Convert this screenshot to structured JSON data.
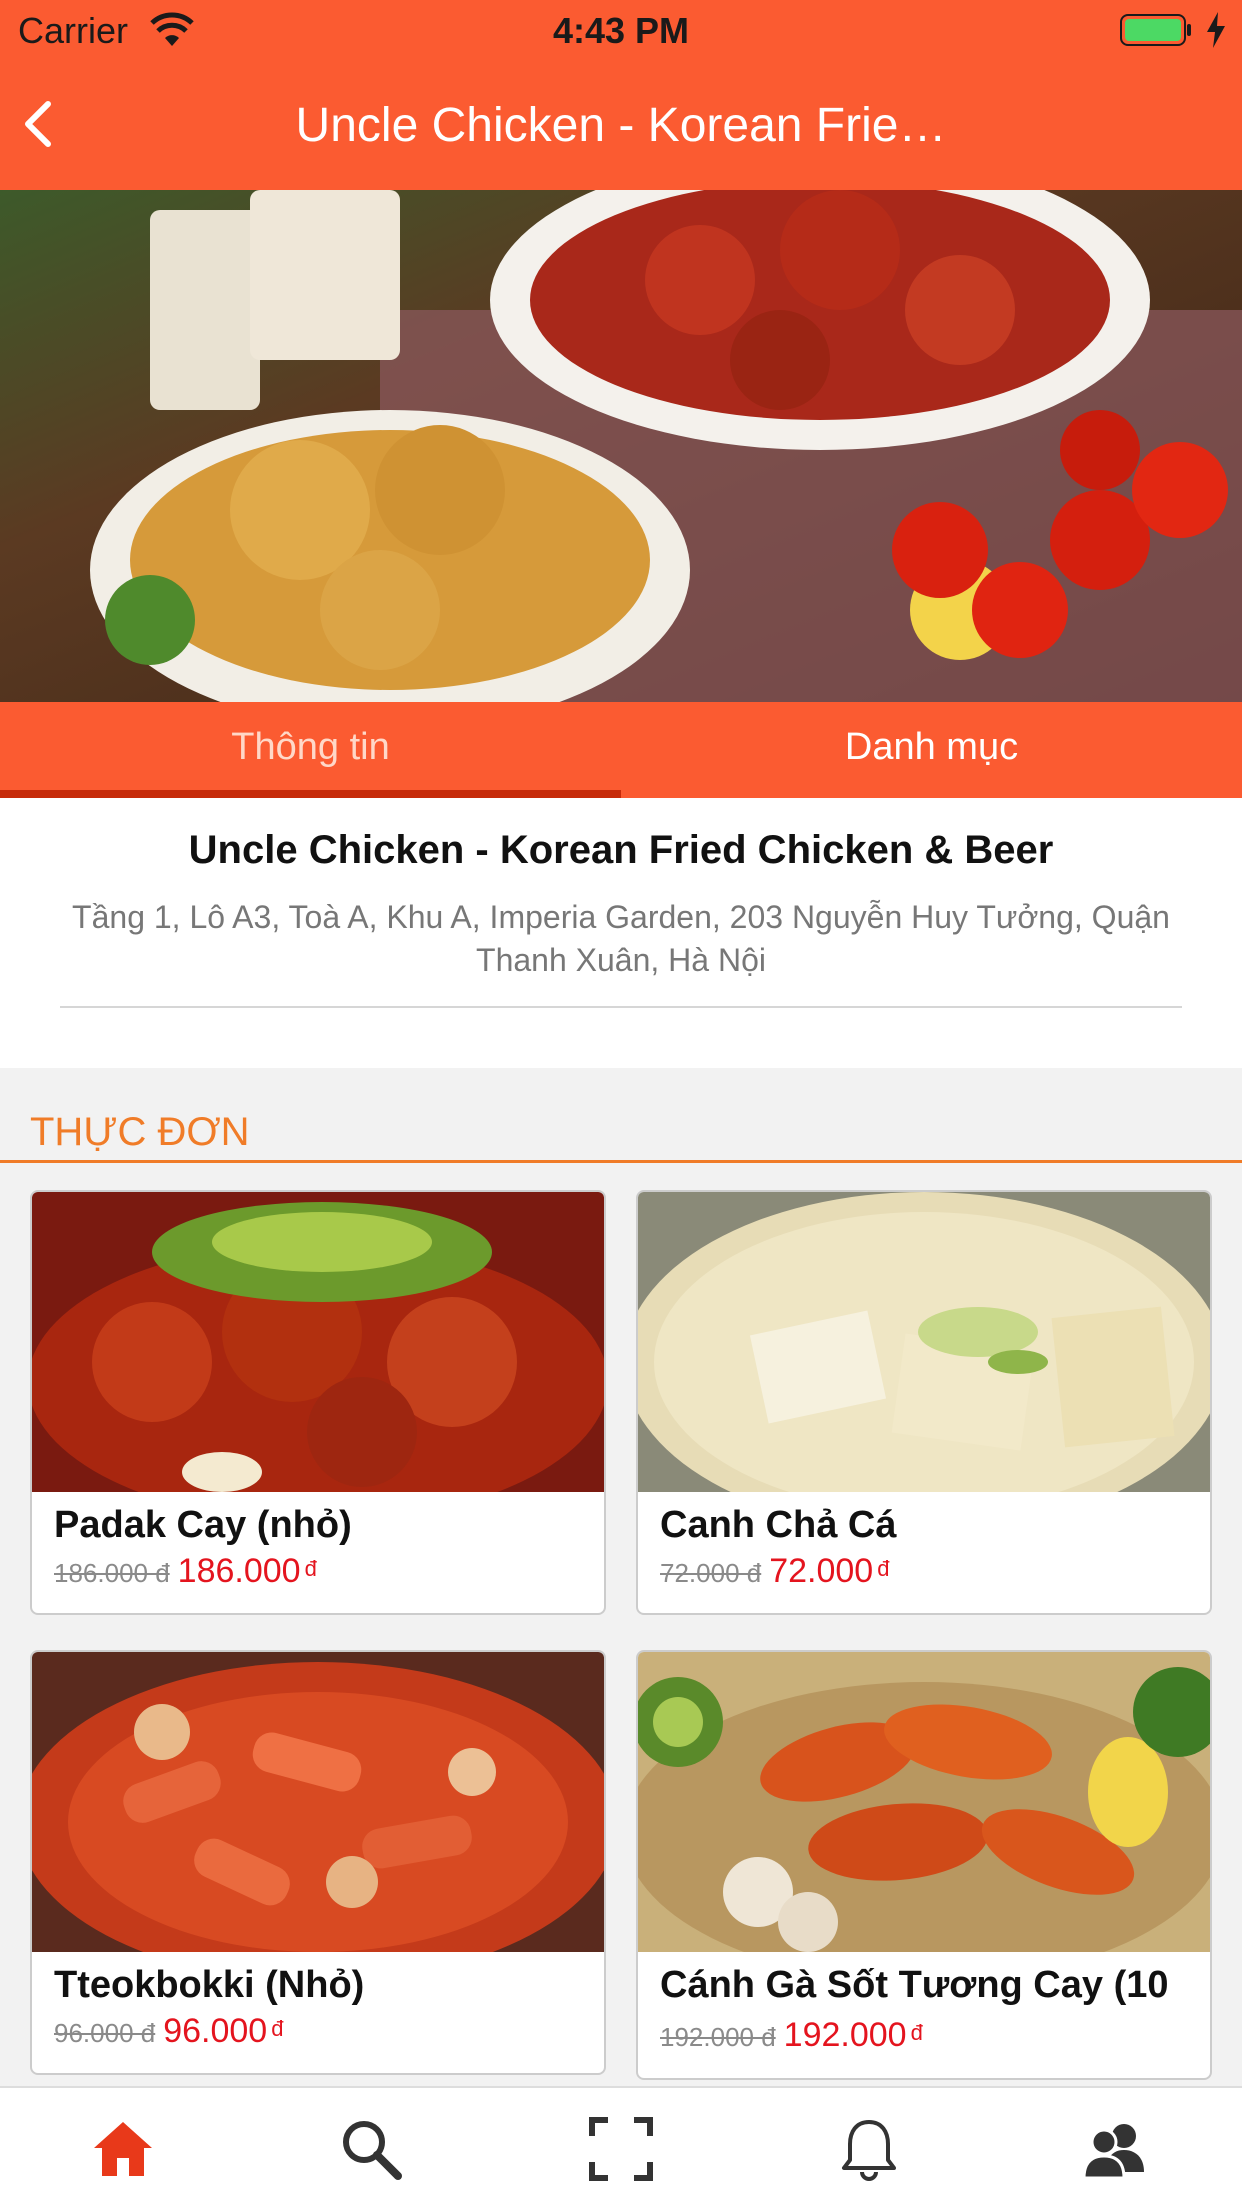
{
  "status_bar": {
    "carrier": "Carrier",
    "time": "4:43 PM"
  },
  "nav": {
    "title": "Uncle Chicken - Korean Frie…",
    "back_icon": "chevron-left-icon"
  },
  "colors": {
    "primary": "#fb5b31",
    "section_accent": "#f07c28",
    "price": "#e4141e",
    "tab_active_icon": "#e8391a"
  },
  "tabs": [
    {
      "label": "Thông tin",
      "selected": true
    },
    {
      "label": "Danh mục",
      "selected": false
    }
  ],
  "restaurant": {
    "name": "Uncle Chicken - Korean Fried Chicken & Beer",
    "address": "Tầng 1, Lô A3, Toà A, Khu A, Imperia Garden, 203 Nguyễn Huy Tưởng, Quận Thanh Xuân, Hà Nội"
  },
  "menu": {
    "title": "THỰC ĐƠN",
    "items": [
      {
        "name": "Padak Cay (nhỏ)",
        "old_price": "186.000 đ",
        "price": "186.000",
        "currency": "đ"
      },
      {
        "name": "Canh Chả Cá",
        "old_price": "72.000 đ",
        "price": "72.000",
        "currency": "đ"
      },
      {
        "name": "Tteokbokki (Nhỏ)",
        "old_price": "96.000 đ",
        "price": "96.000",
        "currency": "đ"
      },
      {
        "name": "Cánh Gà Sốt Tương Cay (10",
        "old_price": "192.000 đ",
        "price": "192.000",
        "currency": "đ"
      }
    ]
  },
  "tab_bar": {
    "items": [
      {
        "icon": "home-icon",
        "active": true
      },
      {
        "icon": "search-icon",
        "active": false
      },
      {
        "icon": "scan-icon",
        "active": false
      },
      {
        "icon": "bell-icon",
        "active": false
      },
      {
        "icon": "users-icon",
        "active": false
      }
    ]
  }
}
